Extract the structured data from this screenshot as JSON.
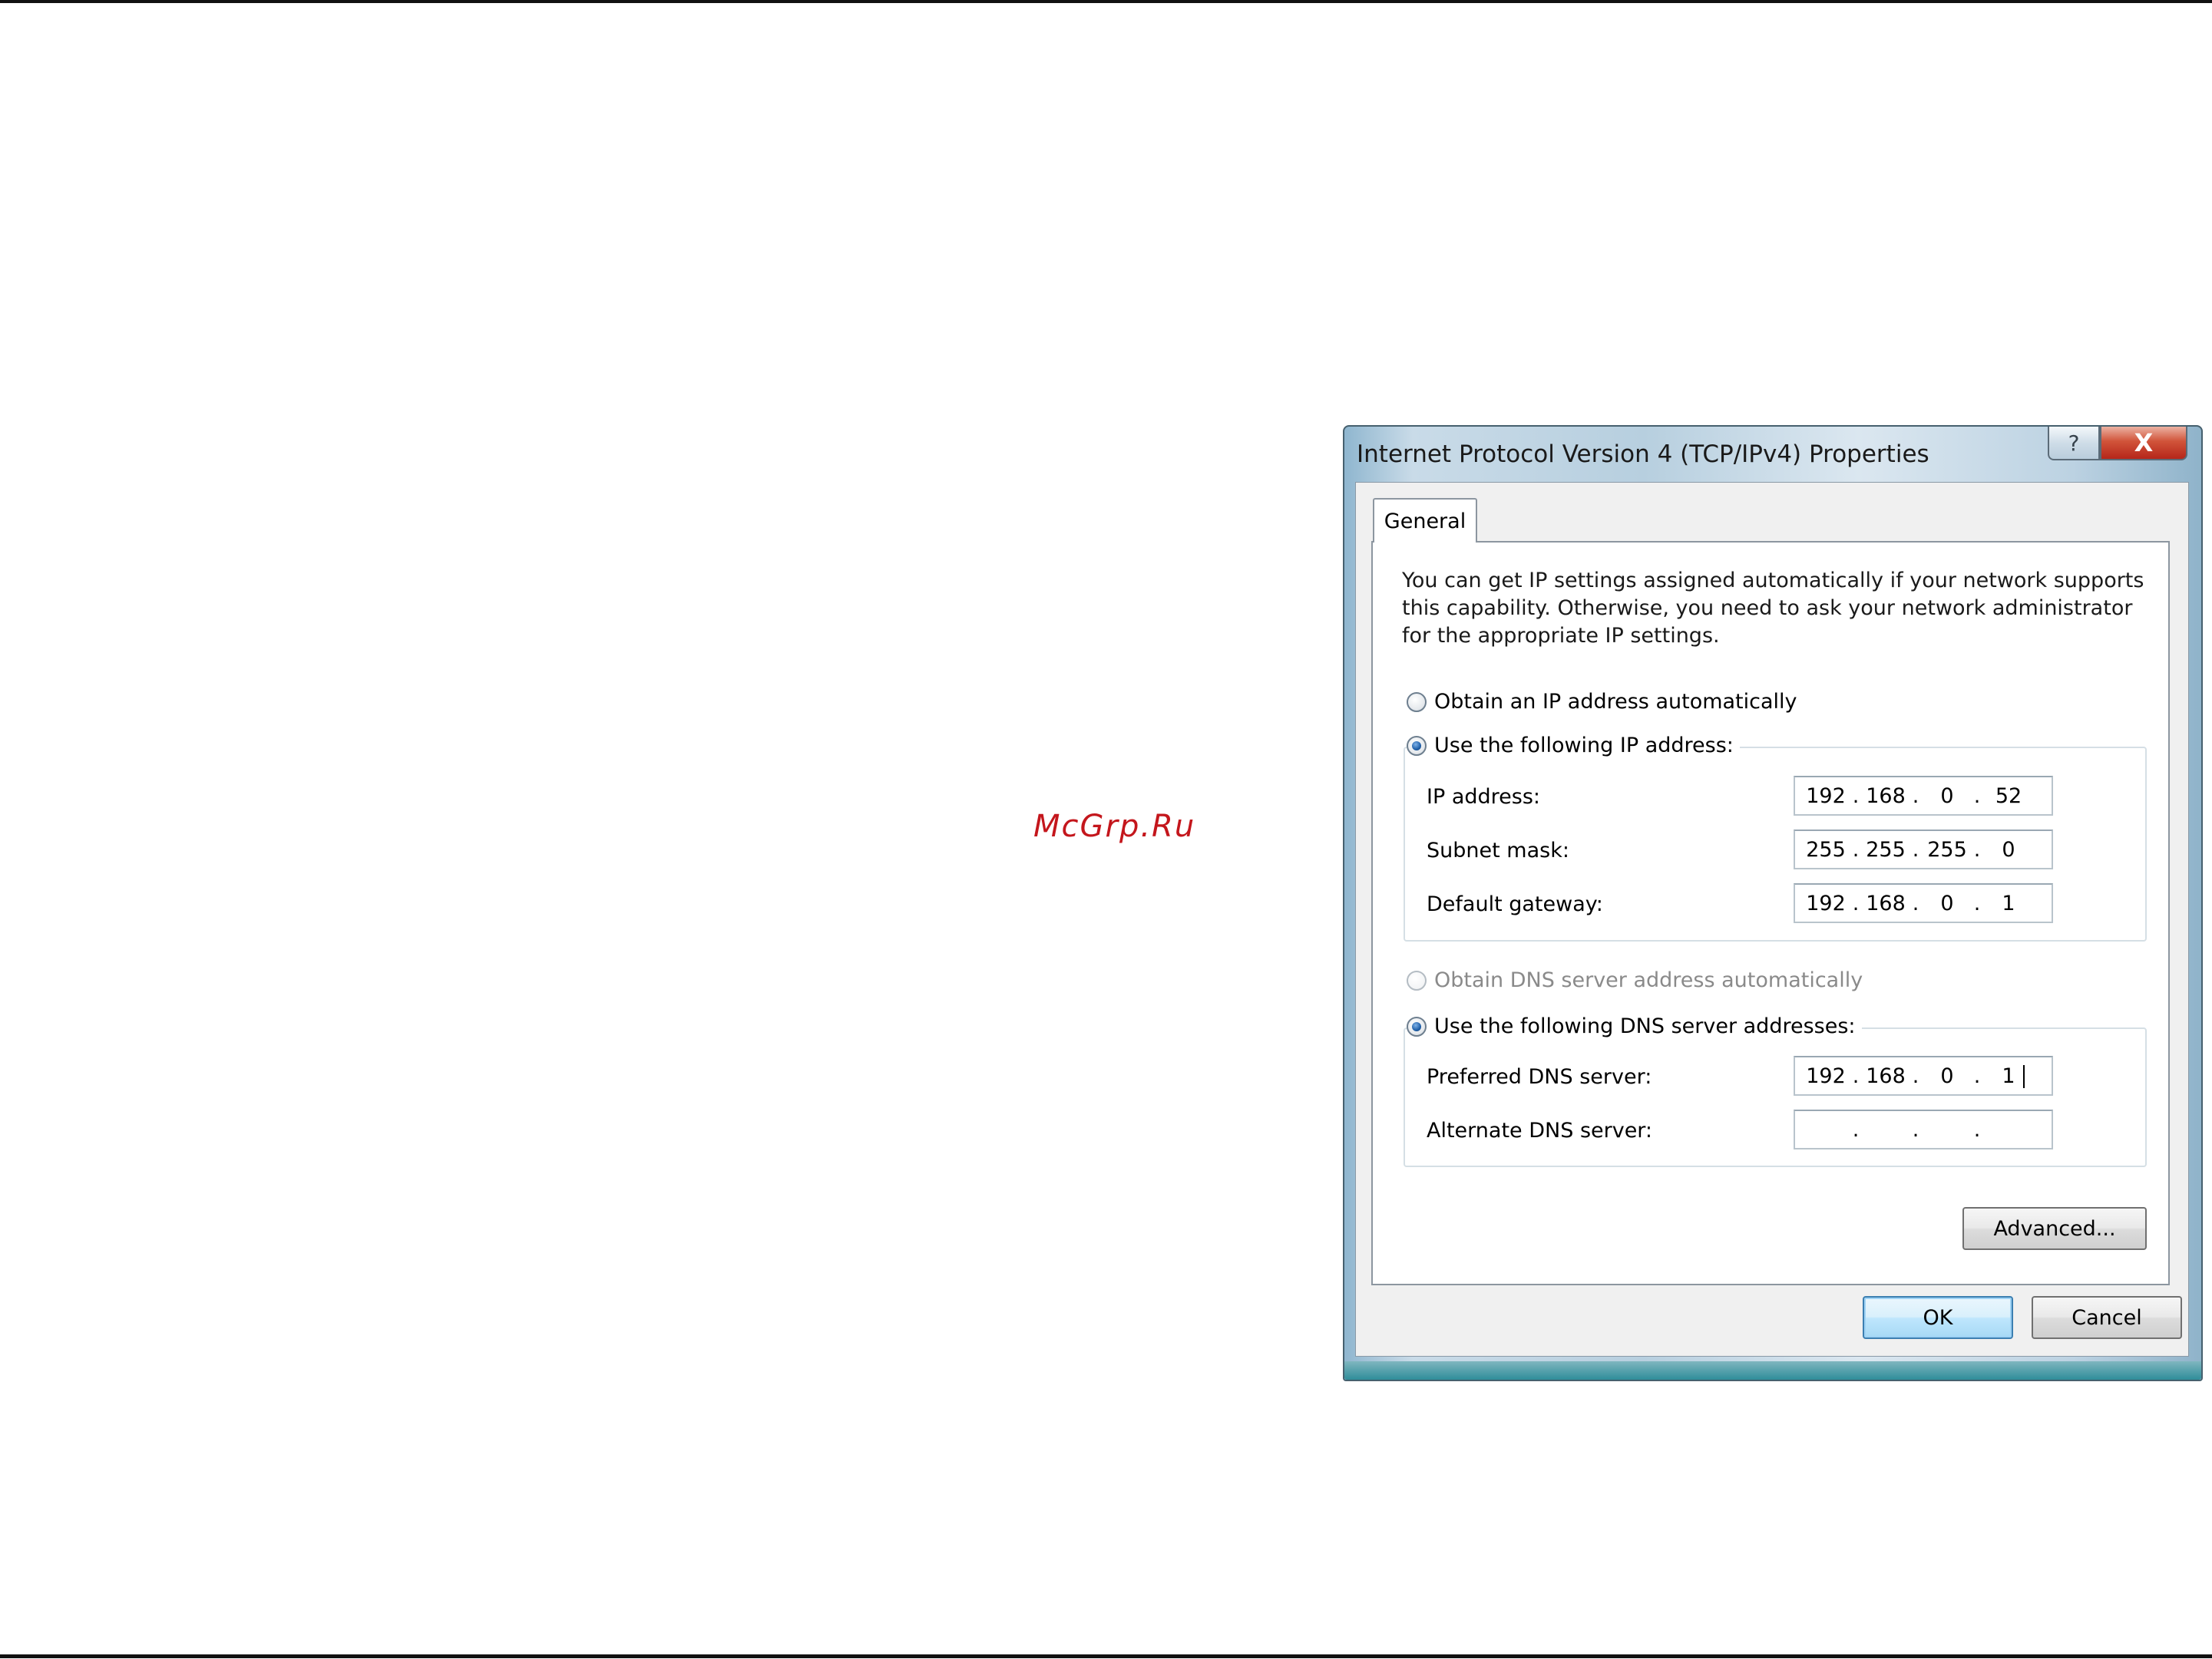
{
  "watermark": "McGrp.Ru",
  "dialog": {
    "title": "Internet Protocol Version 4 (TCP/IPv4) Properties",
    "help_glyph": "?",
    "close_glyph": "X",
    "tab_label": "General",
    "intro_text": "You can get IP settings assigned automatically if your network supports this capability. Otherwise, you need to ask your network administrator for the appropriate IP settings.",
    "ip_section": {
      "auto_label": "Obtain an IP address automatically",
      "auto_selected": false,
      "manual_label": "Use the following IP address:",
      "manual_selected": true,
      "ip_address": {
        "label": "IP address:",
        "octets": [
          "192",
          "168",
          "0",
          "52"
        ]
      },
      "subnet_mask": {
        "label": "Subnet mask:",
        "octets": [
          "255",
          "255",
          "255",
          "0"
        ]
      },
      "default_gateway": {
        "label": "Default gateway:",
        "octets": [
          "192",
          "168",
          "0",
          "1"
        ]
      }
    },
    "dns_section": {
      "auto_label": "Obtain DNS server address automatically",
      "auto_selected": false,
      "auto_disabled": true,
      "manual_label": "Use the following DNS server addresses:",
      "manual_selected": true,
      "preferred": {
        "label": "Preferred DNS server:",
        "octets": [
          "192",
          "168",
          "0",
          "1"
        ]
      },
      "alternate": {
        "label": "Alternate DNS server:",
        "octets": [
          "",
          "",
          "",
          ""
        ]
      }
    },
    "buttons": {
      "advanced": "Advanced...",
      "ok": "OK",
      "cancel": "Cancel"
    }
  }
}
